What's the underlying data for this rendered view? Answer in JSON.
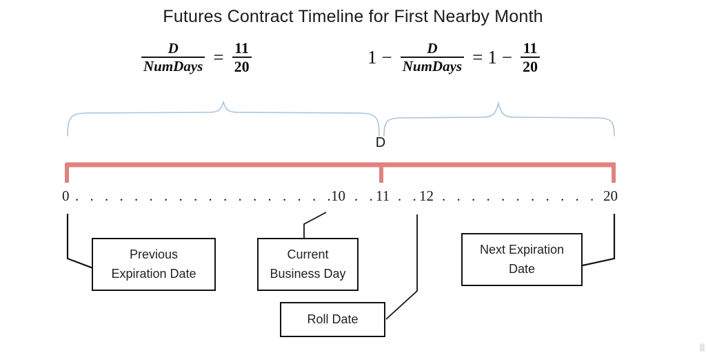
{
  "title": "Futures Contract Timeline for First Nearby Month",
  "formulas": {
    "left": {
      "numerator": "D",
      "denominator": "NumDays",
      "equals": "=",
      "result_numerator": "11",
      "result_denominator": "20"
    },
    "right": {
      "one": "1",
      "minus": "−",
      "numerator": "D",
      "denominator": "NumDays",
      "equals": "=",
      "result_one": "1",
      "result_minus": "−",
      "result_numerator": "11",
      "result_denominator": "20"
    }
  },
  "brace_label": "D",
  "axis": {
    "ticks": [
      "0",
      "10",
      "11",
      "12",
      "20"
    ],
    "dots": {
      "seg1": ". . . . . . . . . . . . . . . . . . . . . . . . .",
      "seg2": ". . .",
      "seg3": ". . .",
      "seg4": ". . . . . . . . . . . . . . . . . . . . . ."
    },
    "range": [
      0,
      20
    ],
    "split_value": 11
  },
  "boxes": {
    "previous_expiration": {
      "line1": "Previous",
      "line2": "Expiration Date"
    },
    "current_business": {
      "line1": "Current",
      "line2": "Business Day"
    },
    "roll_date": {
      "line1": "Roll Date"
    },
    "next_expiration": {
      "line1": "Next Expiration",
      "line2": "Date"
    }
  },
  "colors": {
    "timeline_bar": "#e0827e",
    "brace": "#a9c4dd",
    "box_border": "#111111",
    "text": "#1a1a1a",
    "background": "#ffffff"
  }
}
